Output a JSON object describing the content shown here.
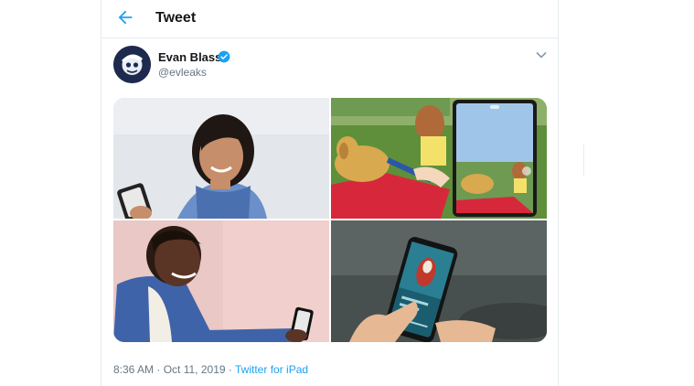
{
  "header": {
    "title": "Tweet",
    "back_icon": "arrow-left-icon",
    "accent": "#1da1f2"
  },
  "tweet": {
    "author_name": "Evan Blass",
    "author_handle": "@evleaks",
    "verified_icon": "verified-badge-icon",
    "menu_icon": "chevron-down-icon",
    "media": [
      {
        "alt": "Woman with short dark hair smiling at a phone"
      },
      {
        "alt": "Woman playing with golden retriever on a red blanket, phone camera view"
      },
      {
        "alt": "Man in blue jacket smiling at a phone"
      },
      {
        "alt": "Hand holding a phone showing a music player"
      }
    ],
    "time": "8:36 AM",
    "date": "Oct 11, 2019",
    "separator": "·",
    "source": "Twitter for iPad"
  }
}
